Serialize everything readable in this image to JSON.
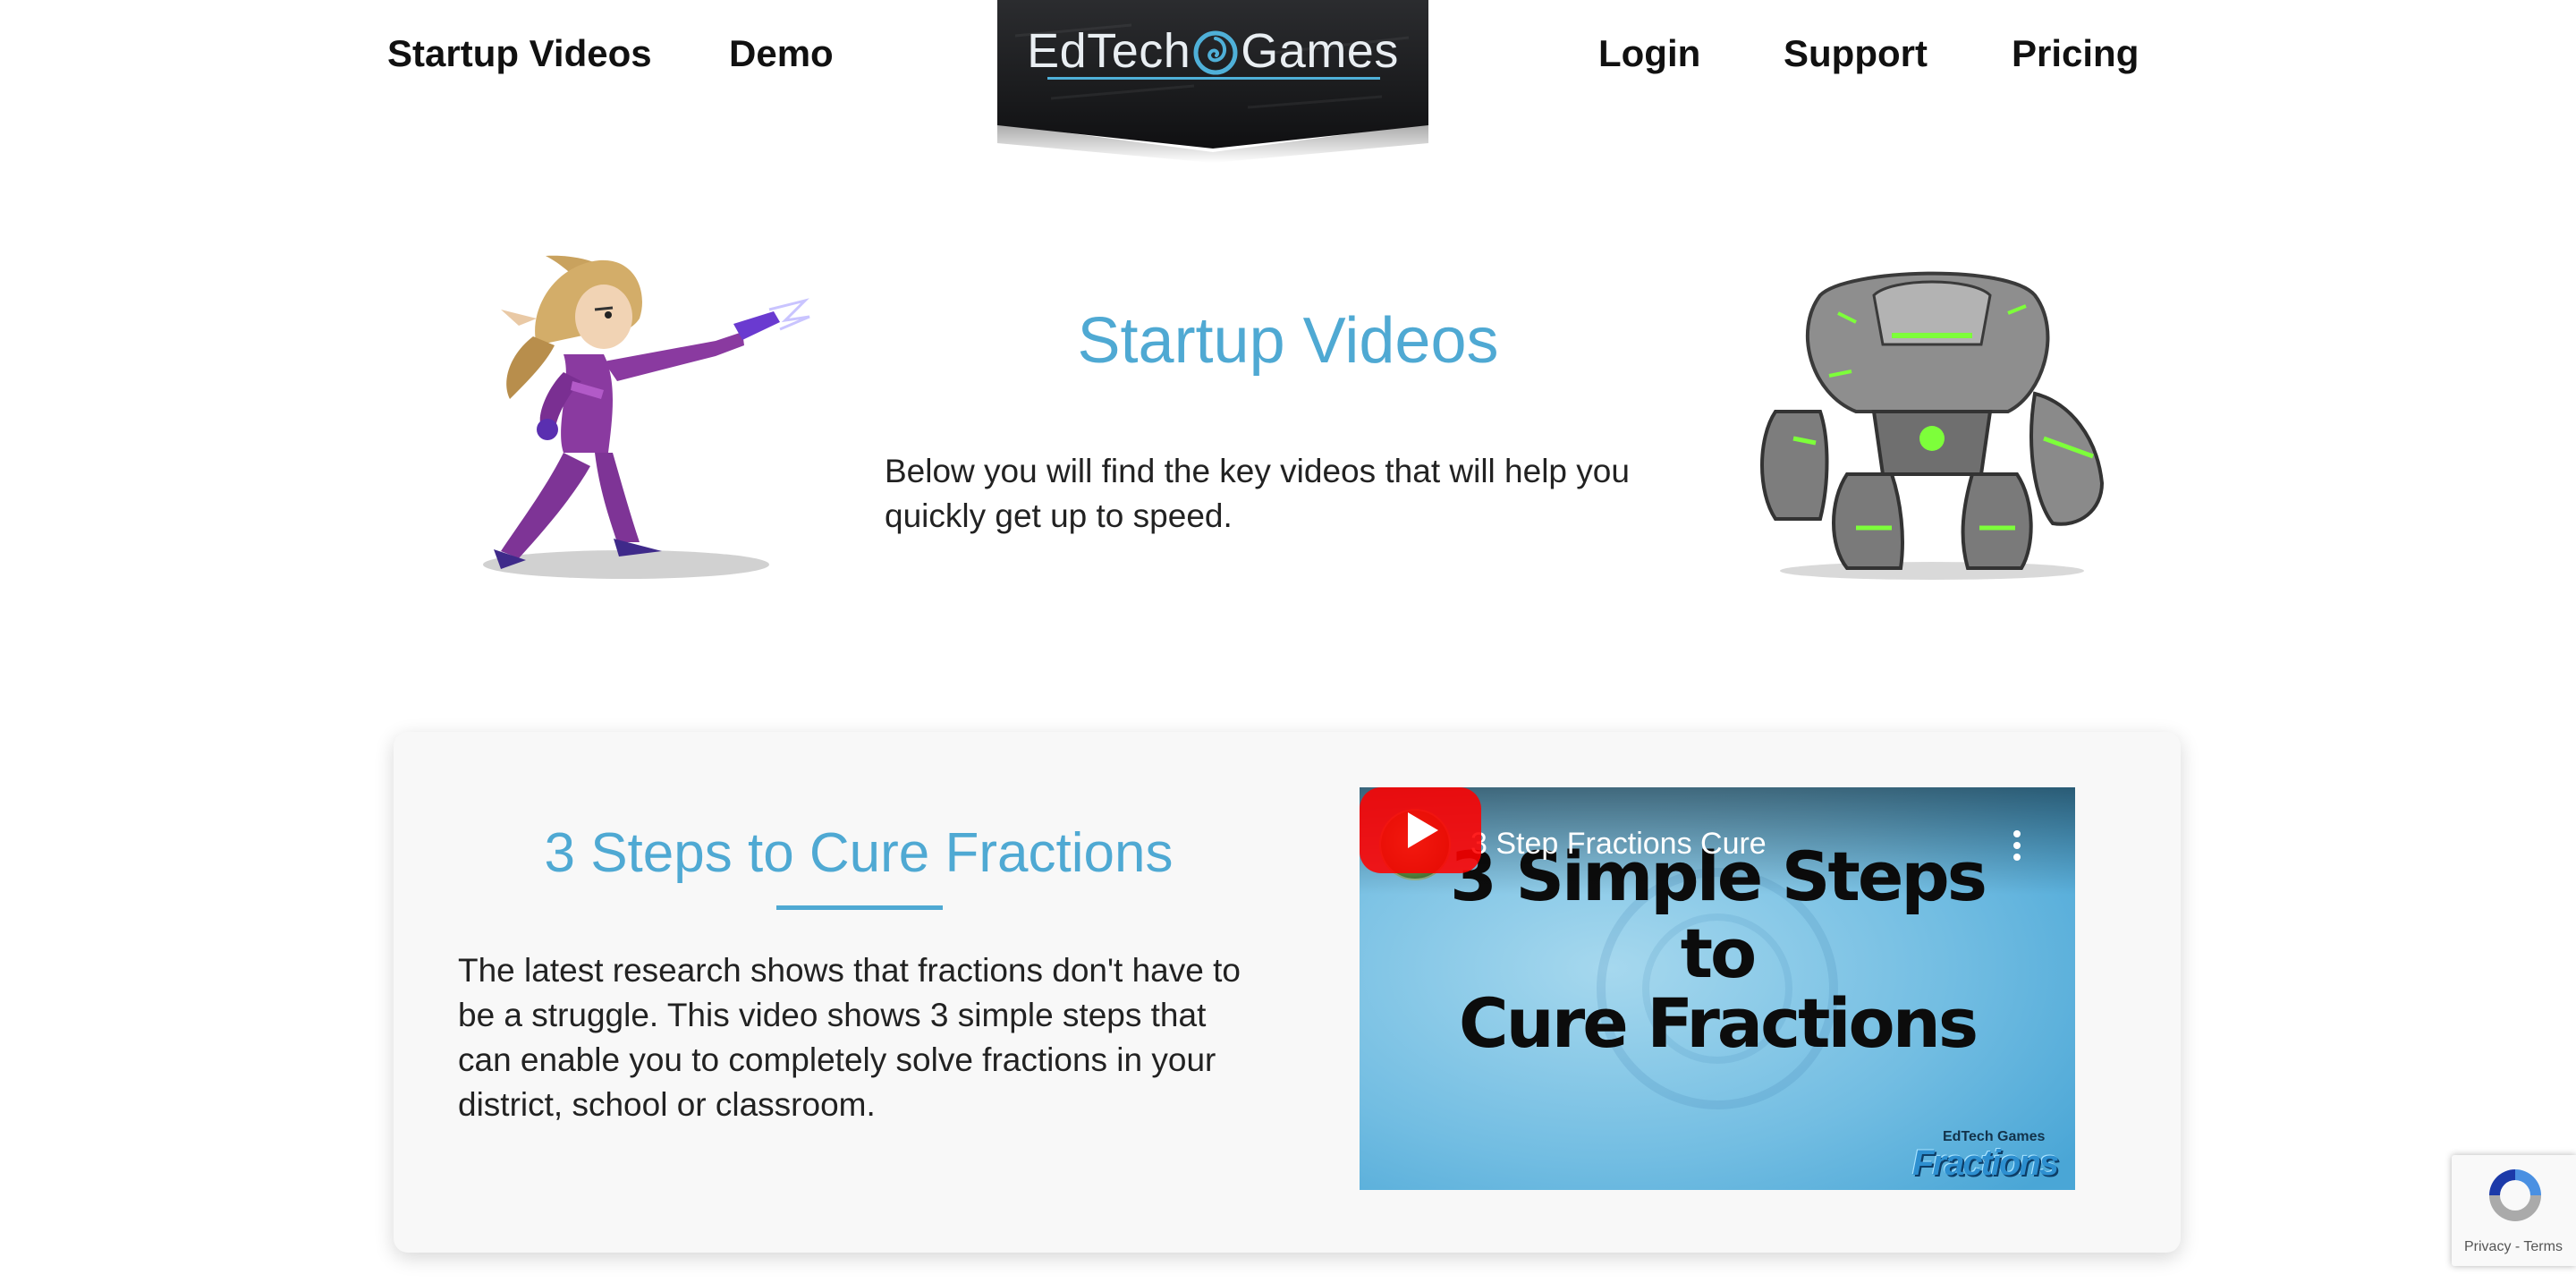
{
  "nav": {
    "left": [
      {
        "label": "Startup Videos"
      },
      {
        "label": "Demo"
      }
    ],
    "right": [
      {
        "label": "Login"
      },
      {
        "label": "Support"
      },
      {
        "label": "Pricing"
      }
    ]
  },
  "logo": {
    "text_left": "EdTech",
    "text_right": "Games"
  },
  "hero": {
    "title": "Startup Videos",
    "description": "Below you will find the key videos that will help you quickly get up to speed."
  },
  "card": {
    "title": "3 Steps to Cure Fractions",
    "description": "The latest research shows that fractions don't have to be a struggle. This video shows 3 simple steps that can enable you to completely solve fractions in your district, school or classroom."
  },
  "video": {
    "title": "3 Step Fractions Cure",
    "headline_line1": "3 Simple Steps",
    "headline_line2": "to",
    "headline_line3": "Cure Fractions",
    "brand_small": "EdTech Games",
    "brand_big": "Fractions",
    "colors": {
      "play": "#ff0000",
      "background": "#6cb8de"
    }
  },
  "recaptcha": {
    "privacy": "Privacy",
    "separator": " - ",
    "terms": "Terms"
  },
  "colors": {
    "accent": "#4fa9d3",
    "logo_bg": "#1e1f21"
  }
}
